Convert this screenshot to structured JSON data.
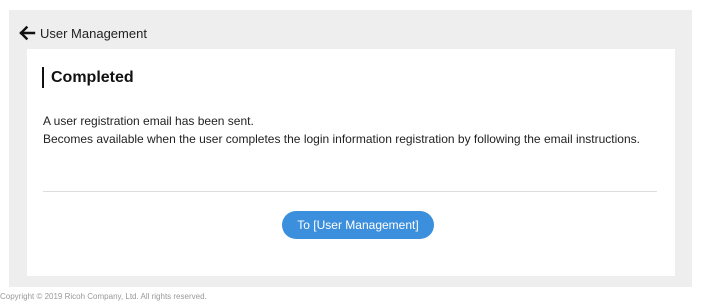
{
  "header": {
    "back_icon": "arrow-left-icon",
    "title": "User Management"
  },
  "card": {
    "heading": "Completed",
    "message_lines": [
      "A user registration email has been sent.",
      "Becomes available when the user completes the login information registration by following the email instructions."
    ],
    "button_label": "To [User Management]"
  },
  "footer": {
    "copyright": "Copyright © 2019 Ricoh Company, Ltd. All rights reserved."
  },
  "colors": {
    "accent": "#3b8fdd",
    "background": "#eeeeee"
  }
}
